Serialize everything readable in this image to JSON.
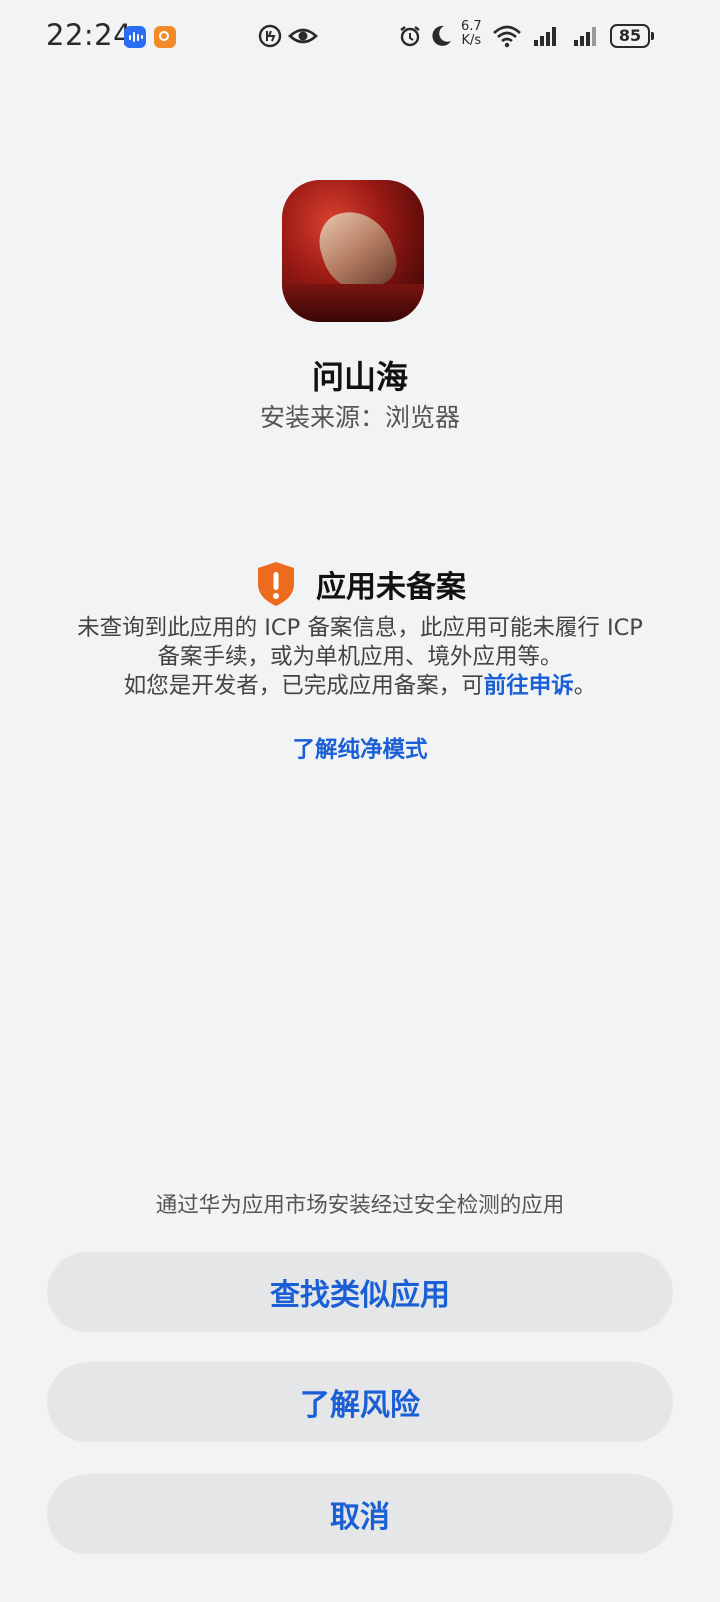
{
  "status_bar": {
    "time": "22:24",
    "net_speed_value": "6.7",
    "net_speed_unit": "K/s",
    "battery": "85",
    "icons": [
      "voice-app-icon",
      "orange-app-icon",
      "data-saver-icon",
      "eye-comfort-icon",
      "alarm-icon",
      "do-not-disturb-icon",
      "wifi-icon",
      "signal-icon",
      "signal-icon-2",
      "battery-icon"
    ]
  },
  "app": {
    "name": "问山海",
    "source": "安装来源：浏览器"
  },
  "warning": {
    "title": "应用未备案",
    "line1": "未查询到此应用的 ICP 备案信息，此应用可能未履行 ICP",
    "line2": "备案手续，或为单机应用、境外应用等。",
    "line3_prefix": "如您是开发者，已完成应用备案，可",
    "line3_link": "前往申诉",
    "line3_suffix": "。",
    "learn_pure_mode": "了解纯净模式"
  },
  "bottom": {
    "hint": "通过华为应用市场安装经过安全检测的应用",
    "find_similar": "查找类似应用",
    "learn_risk": "了解风险",
    "cancel": "取消"
  },
  "colors": {
    "accent": "#1a5fd6",
    "warning": "#ec6b1e",
    "background": "#f1f3f5",
    "button_bg": "#e5e6e8"
  }
}
